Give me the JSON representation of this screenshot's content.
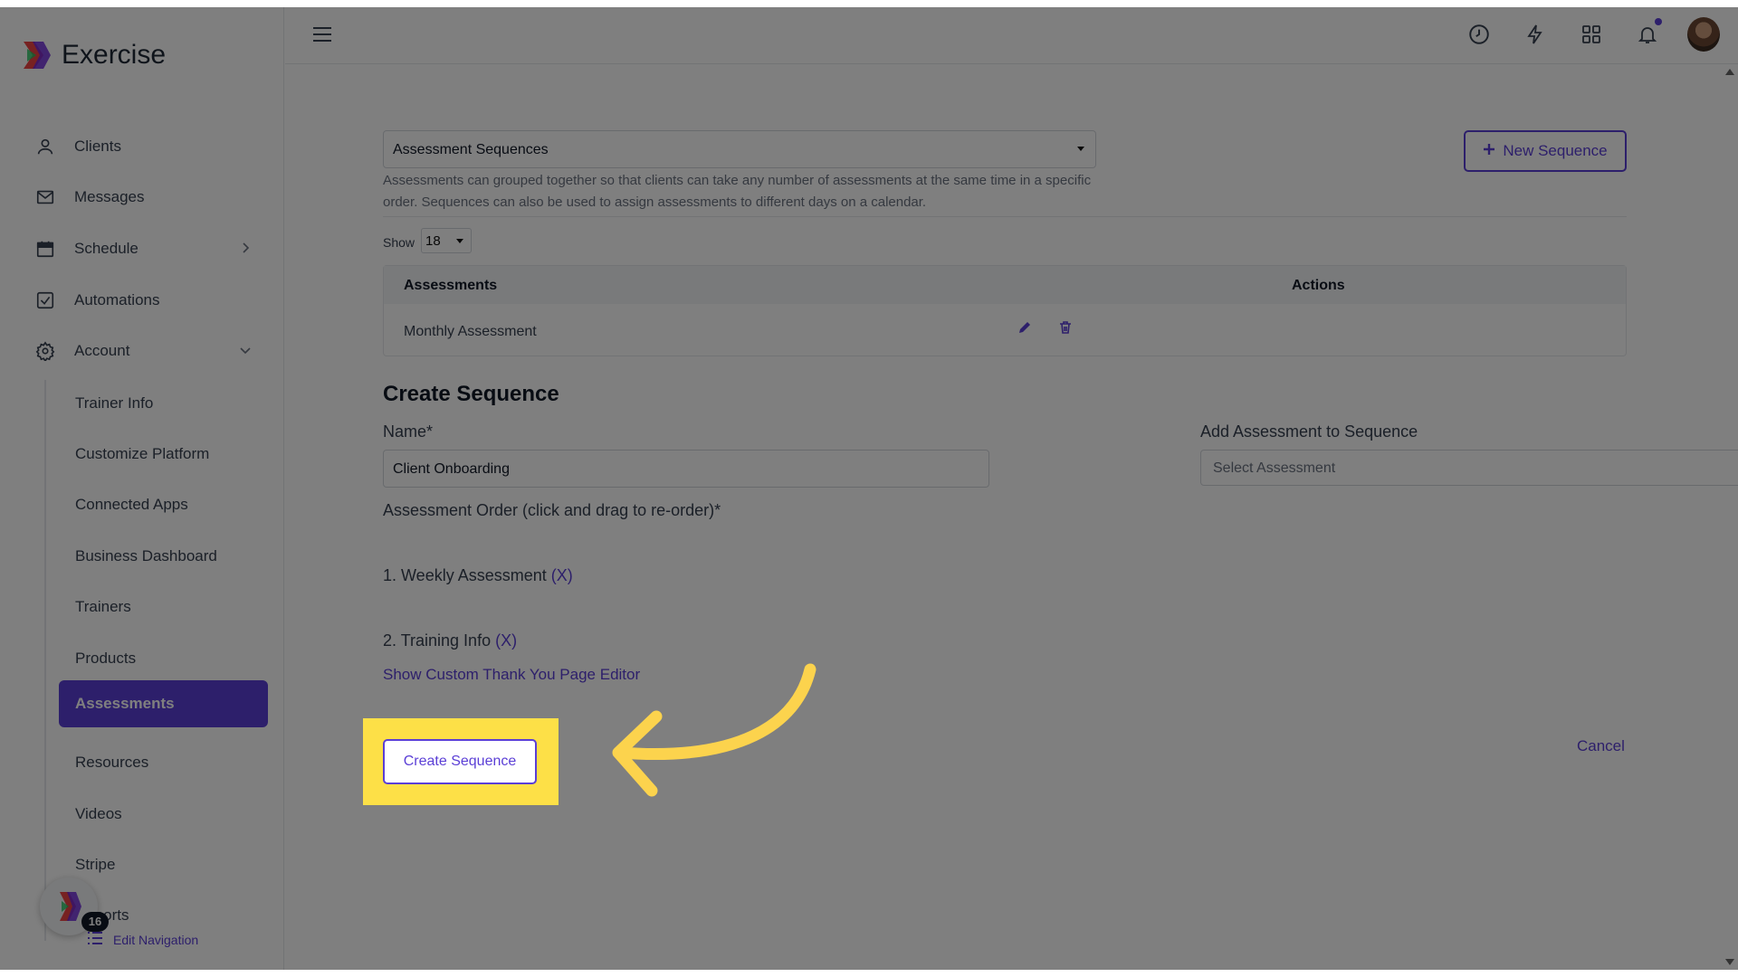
{
  "app": {
    "name": "Exercise"
  },
  "sidebar": {
    "items": [
      {
        "label": "Clients",
        "icon": "user-icon"
      },
      {
        "label": "Messages",
        "icon": "mail-icon"
      },
      {
        "label": "Schedule",
        "icon": "calendar-icon"
      },
      {
        "label": "Automations",
        "icon": "checkbox-icon"
      },
      {
        "label": "Account",
        "icon": "gear-icon"
      }
    ],
    "account_subitems": [
      "Trainer Info",
      "Customize Platform",
      "Connected Apps",
      "Business Dashboard",
      "Trainers",
      "Products",
      "Assessments",
      "Resources",
      "Videos",
      "Stripe",
      "Reports"
    ],
    "active_subitem": "Assessments",
    "help_badge_count": "16",
    "edit_navigation_label": "Edit Navigation"
  },
  "topbar": {
    "icons": [
      "clock-icon",
      "lightning-icon",
      "grid-icon",
      "bell-icon",
      "avatar"
    ]
  },
  "main": {
    "view_select": "Assessment Sequences",
    "description": "Assessments can grouped together so that clients can take any number of assessments at the same time in a specific order. Sequences can also be used to assign assessments to different days on a calendar.",
    "new_sequence_label": "New Sequence",
    "show_label": "Show",
    "show_value": "18",
    "table": {
      "columns": [
        "Assessments",
        "Actions"
      ],
      "rows": [
        {
          "name": "Monthly Assessment"
        }
      ]
    },
    "create_title": "Create Sequence",
    "name_label": "Name*",
    "name_value": "Client Onboarding",
    "add_label": "Add Assessment to Sequence",
    "add_placeholder": "Select Assessment",
    "order_label": "Assessment Order (click and drag to re-order)*",
    "order_items": [
      {
        "text": "1. Weekly Assessment",
        "remove": "(X)"
      },
      {
        "text": "2. Training Info",
        "remove": "(X)"
      }
    ],
    "thank_you_link": "Show Custom Thank You Page Editor",
    "create_button": "Create Sequence",
    "cancel_link": "Cancel"
  },
  "colors": {
    "accent": "#5b3fd6",
    "highlight": "#fde047",
    "arrow": "#fcd34d"
  }
}
